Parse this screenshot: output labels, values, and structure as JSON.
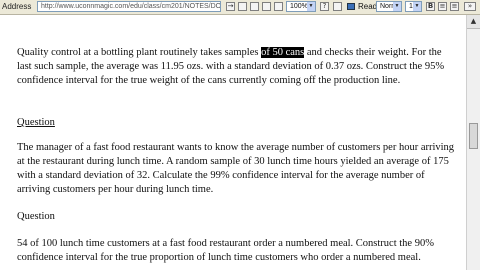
{
  "toolbar": {
    "address_label": "Address",
    "url": "http://www.uconnmagic.com/edu/class/cm201/NOTES/DOCS/class14.doc",
    "zoom": "100%",
    "style": "Normal",
    "font_size": "12",
    "read_label": "Read"
  },
  "document": {
    "p1_before": "Quality control at a bottling plant routinely takes samples ",
    "p1_highlight": "of 50 cans",
    "p1_after": " and checks their weight.  For the last such sample, the average was 11.95 ozs. with a standard deviation of 0.37 ozs.  Construct the 95% confidence interval for the true weight of the cans currently coming off the production line.",
    "heading1": "Question",
    "p2": "The manager of a fast food restaurant wants to know the average number of customers per hour arriving at the restaurant during lunch time.  A random sample of 30 lunch time hours yielded an average of 175 with a standard deviation of 32.  Calculate the 99% confidence interval for the average number of arriving customers per hour during lunch time.",
    "heading2": "Question",
    "p3": "54 of 100 lunch time customers at a fast food restaurant order a numbered meal.  Construct the 90% confidence interval for the true proportion of lunch time customers who order a numbered meal."
  }
}
